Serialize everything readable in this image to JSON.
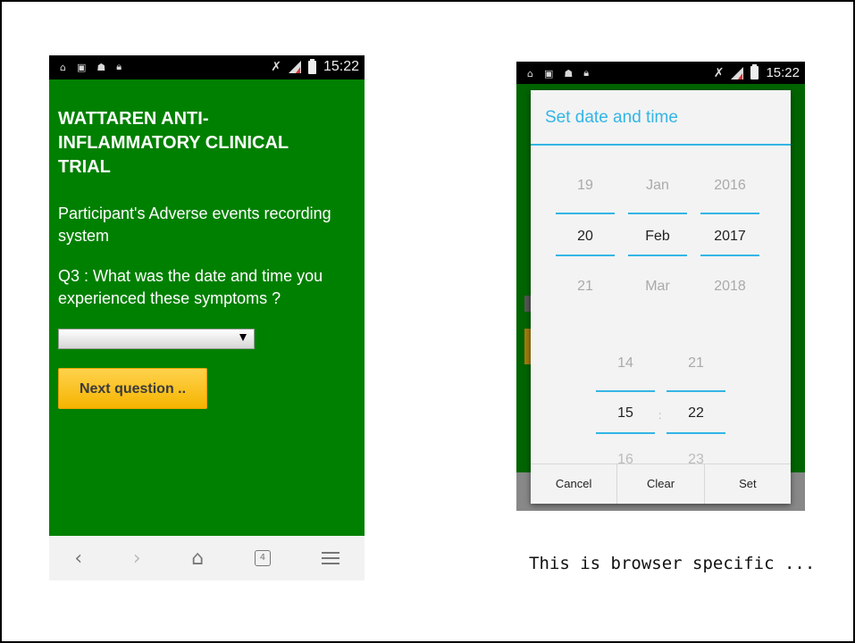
{
  "left_phone": {
    "status": {
      "time": "15:22"
    },
    "title": "WATTAREN ANTI-INFLAMMATORY CLINICAL TRIAL",
    "subtitle": "Participant's Adverse events recording system",
    "question": "Q3 : What was the date and time you experienced these symptoms ?",
    "date_select_value": "",
    "next_button_label": "Next question ..",
    "nav": {
      "tab_count": "4"
    }
  },
  "right_phone": {
    "status": {
      "time": "15:22"
    },
    "dialog": {
      "title": "Set date and time",
      "day": {
        "prev": "19",
        "current": "20",
        "next": "21"
      },
      "month": {
        "prev": "Jan",
        "current": "Feb",
        "next": "Mar"
      },
      "year": {
        "prev": "2016",
        "current": "2017",
        "next": "2018"
      },
      "hour": {
        "prev": "14",
        "current": "15",
        "next": "16"
      },
      "minute": {
        "prev": "21",
        "current": "22",
        "next": "23"
      },
      "time_separator": ":",
      "buttons": {
        "cancel": "Cancel",
        "clear": "Clear",
        "set": "Set"
      }
    }
  },
  "caption": "This is browser specific ...",
  "colors": {
    "app_green": "#008000",
    "button_yellow": "#f5b400",
    "holo_blue": "#33b5e5"
  },
  "icons": [
    "photo-icon",
    "android-icon",
    "lock-icon",
    "mute-icon",
    "signal-icon",
    "battery-icon",
    "back-icon",
    "forward-icon",
    "home-icon",
    "tabs-icon",
    "menu-icon"
  ]
}
